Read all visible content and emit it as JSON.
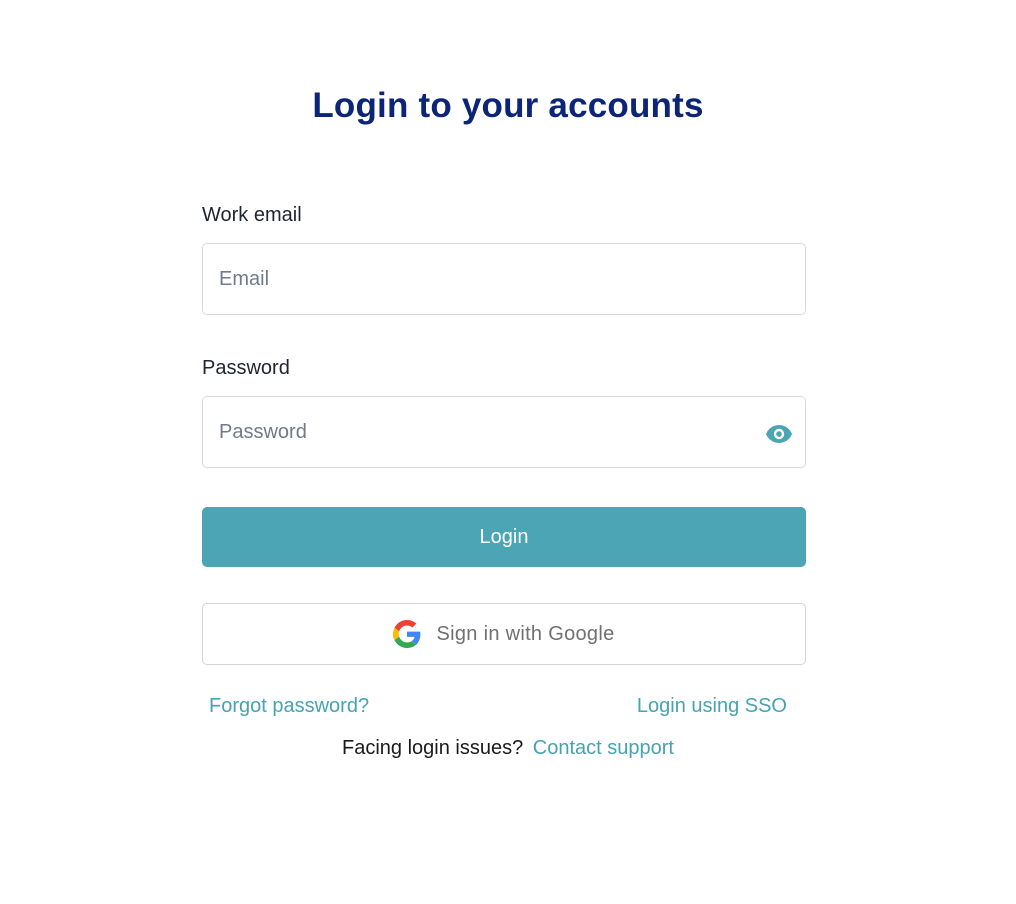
{
  "page": {
    "title": "Login to your accounts"
  },
  "form": {
    "email": {
      "label": "Work email",
      "placeholder": "Email",
      "value": ""
    },
    "password": {
      "label": "Password",
      "placeholder": "Password",
      "value": "",
      "toggle_icon": "eye-icon"
    },
    "login_button": "Login",
    "google_button": {
      "label": "Sign in with Google",
      "icon": "google-icon"
    }
  },
  "links": {
    "forgot_password": "Forgot password?",
    "sso": "Login using SSO"
  },
  "support": {
    "text": "Facing login issues?",
    "link": "Contact support"
  },
  "colors": {
    "title": "#0c2577",
    "accent": "#4ba5b5",
    "link": "#46a3b2",
    "input_border": "#d7dbe0"
  }
}
